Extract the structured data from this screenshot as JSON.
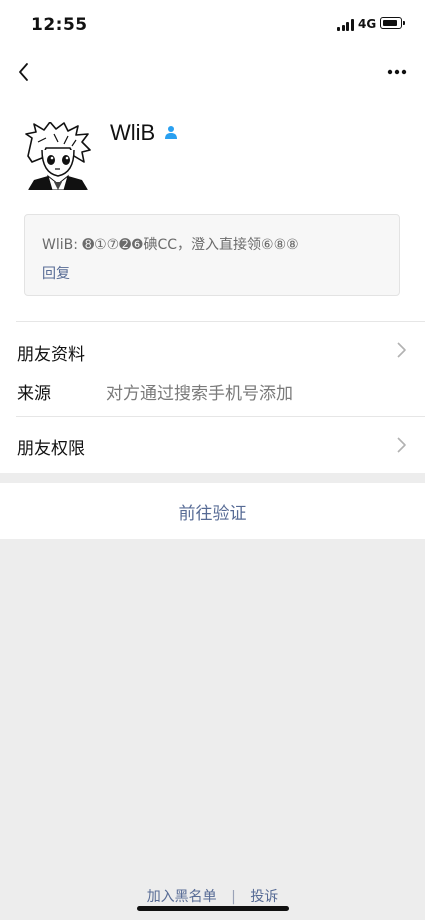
{
  "status_bar": {
    "time": "12:55",
    "network": "4G"
  },
  "profile": {
    "nickname": "WliB",
    "badge_icon": "contact-person-icon",
    "badge_color": "#2aa0f0"
  },
  "message": {
    "text": "WliB: ➑①⑦➋❻碘CC，澄入直接领⑥⑧⑧",
    "reply_label": "回复"
  },
  "rows": {
    "friend_profile": {
      "label": "朋友资料",
      "icon": "chevron-right-icon"
    },
    "source": {
      "label": "来源",
      "value": "对方通过搜索手机号添加"
    },
    "friend_permissions": {
      "label": "朋友权限",
      "icon": "chevron-right-icon"
    }
  },
  "verify": {
    "label": "前往验证"
  },
  "footer": {
    "blacklist": "加入黑名单",
    "separator": "|",
    "report": "投诉"
  },
  "colors": {
    "link": "#576b95",
    "background": "#ededed",
    "panel": "#ffffff"
  }
}
